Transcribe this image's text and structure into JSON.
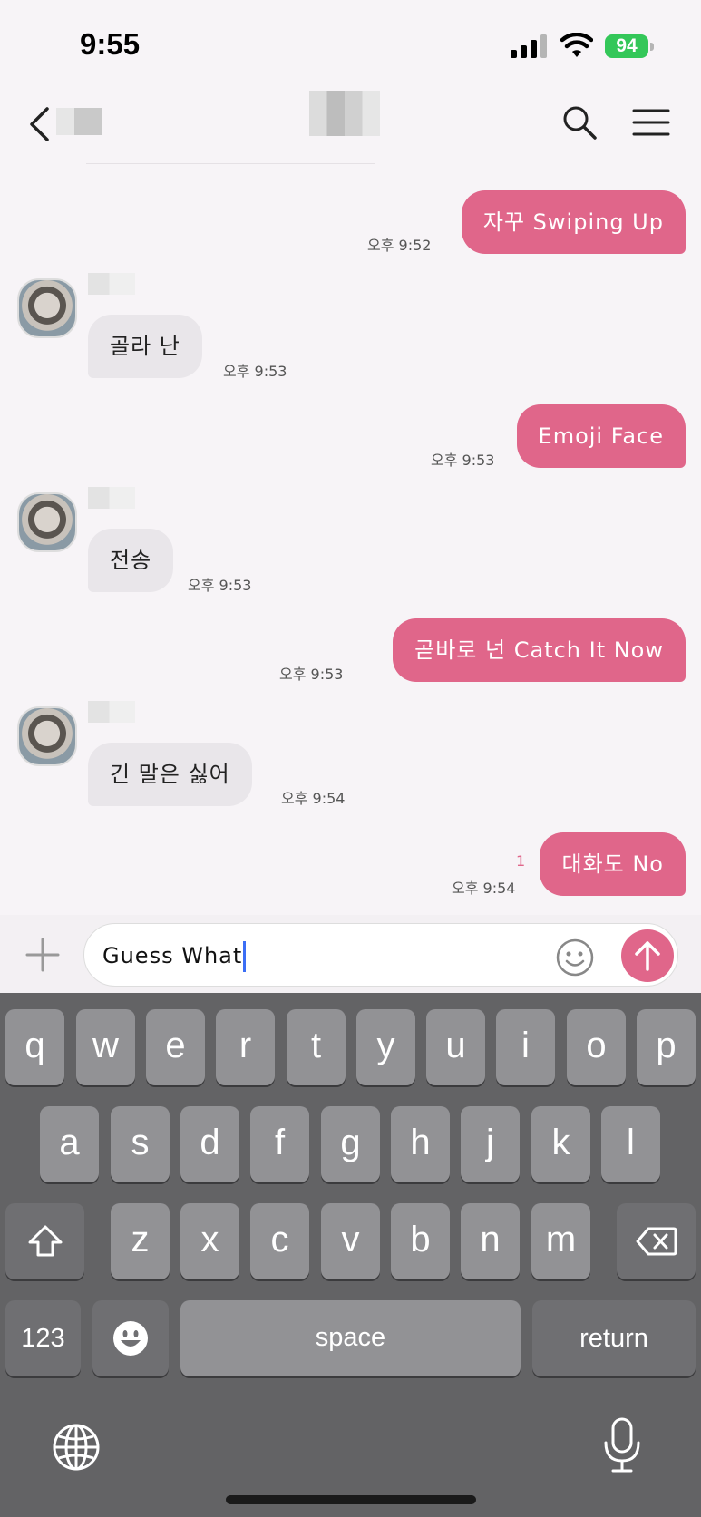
{
  "status_bar": {
    "time": "9:55",
    "battery": "94"
  },
  "messages": [
    {
      "text": "자꾸 Swiping Up",
      "time": "오후 9:52",
      "from": "me"
    },
    {
      "text": "골라 난",
      "time": "오후 9:53",
      "from": "other"
    },
    {
      "text": "Emoji Face",
      "time": "오후 9:53",
      "from": "me"
    },
    {
      "text": "전송",
      "time": "오후 9:53",
      "from": "other"
    },
    {
      "text": "곧바로 넌 Catch It Now",
      "time": "오후 9:53",
      "from": "me"
    },
    {
      "text": "긴 말은 싫어",
      "time": "오후 9:54",
      "from": "other"
    },
    {
      "text": "대화도 No",
      "time": "오후 9:54",
      "from": "me",
      "unread": "1"
    }
  ],
  "composer": {
    "text": "Guess What"
  },
  "keyboard": {
    "row1": [
      "q",
      "w",
      "e",
      "r",
      "t",
      "y",
      "u",
      "i",
      "o",
      "p"
    ],
    "row2": [
      "a",
      "s",
      "d",
      "f",
      "g",
      "h",
      "j",
      "k",
      "l"
    ],
    "row3": [
      "z",
      "x",
      "c",
      "v",
      "b",
      "n",
      "m"
    ],
    "numbers_label": "123",
    "space_label": "space",
    "return_label": "return"
  },
  "colors": {
    "accent": "#e0668a",
    "incoming_bubble": "#e9e6ea",
    "keyboard_bg": "#636365",
    "key_bg": "#929295"
  },
  "icons": [
    "back-icon",
    "search-icon",
    "menu-icon",
    "plus-icon",
    "emoji-icon",
    "send-arrow-icon",
    "shift-icon",
    "backspace-icon",
    "emoji-keyboard-icon",
    "globe-icon",
    "mic-icon"
  ]
}
